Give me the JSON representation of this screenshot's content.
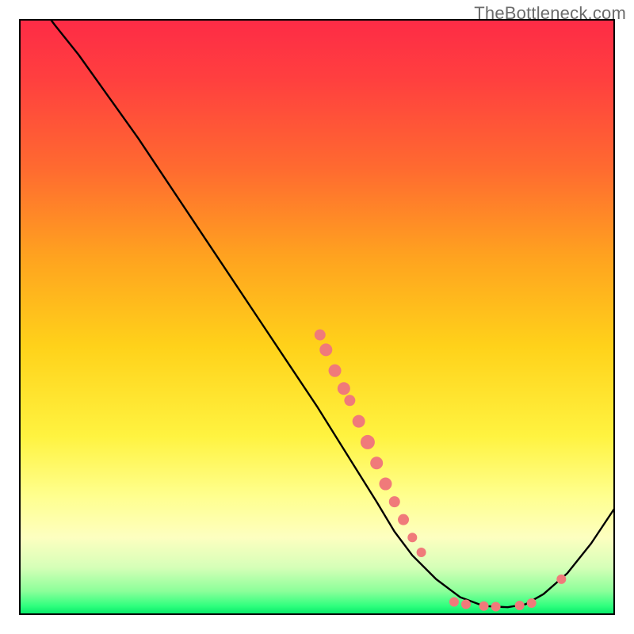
{
  "watermark": "TheBottleneck.com",
  "chart_data": {
    "type": "line",
    "title": "",
    "xlabel": "",
    "ylabel": "",
    "xlim": [
      0,
      100
    ],
    "ylim": [
      0,
      100
    ],
    "grid": false,
    "series": [
      {
        "name": "curve",
        "x": [
          0,
          3,
          6,
          10,
          15,
          20,
          25,
          30,
          35,
          40,
          45,
          50,
          55,
          60,
          63,
          66,
          70,
          74,
          78,
          82,
          85,
          88,
          92,
          96,
          100
        ],
        "y": [
          107,
          103,
          99,
          94,
          87,
          80,
          72.5,
          65,
          57.5,
          50,
          42.5,
          35,
          27,
          19,
          14,
          10,
          6,
          3,
          1.5,
          1.3,
          1.8,
          3.5,
          7,
          12,
          18
        ]
      }
    ],
    "points": [
      {
        "name": "cluster-upper",
        "x": 50.5,
        "y": 47,
        "r": 7
      },
      {
        "name": "cluster-upper",
        "x": 51.5,
        "y": 44.5,
        "r": 8
      },
      {
        "name": "cluster-upper",
        "x": 53,
        "y": 41,
        "r": 8
      },
      {
        "name": "cluster-upper",
        "x": 54.5,
        "y": 38,
        "r": 8
      },
      {
        "name": "cluster-upper",
        "x": 55.5,
        "y": 36,
        "r": 7
      },
      {
        "name": "cluster-mid",
        "x": 57,
        "y": 32.5,
        "r": 8
      },
      {
        "name": "cluster-mid",
        "x": 58.5,
        "y": 29,
        "r": 9
      },
      {
        "name": "cluster-mid",
        "x": 60,
        "y": 25.5,
        "r": 8
      },
      {
        "name": "cluster-mid",
        "x": 61.5,
        "y": 22,
        "r": 8
      },
      {
        "name": "cluster-low",
        "x": 63,
        "y": 19,
        "r": 7
      },
      {
        "name": "cluster-low",
        "x": 64.5,
        "y": 16,
        "r": 7
      },
      {
        "name": "cluster-low",
        "x": 66,
        "y": 13,
        "r": 6
      },
      {
        "name": "cluster-low",
        "x": 67.5,
        "y": 10.5,
        "r": 6
      },
      {
        "name": "bottom-left",
        "x": 73,
        "y": 2.2,
        "r": 6
      },
      {
        "name": "bottom-left",
        "x": 75,
        "y": 1.8,
        "r": 6
      },
      {
        "name": "bottom-mid",
        "x": 78,
        "y": 1.5,
        "r": 6
      },
      {
        "name": "bottom-mid",
        "x": 80,
        "y": 1.4,
        "r": 6
      },
      {
        "name": "bottom-right",
        "x": 84,
        "y": 1.6,
        "r": 6
      },
      {
        "name": "bottom-right",
        "x": 86,
        "y": 2.0,
        "r": 6
      },
      {
        "name": "rising",
        "x": 91,
        "y": 6.0,
        "r": 6
      }
    ]
  }
}
